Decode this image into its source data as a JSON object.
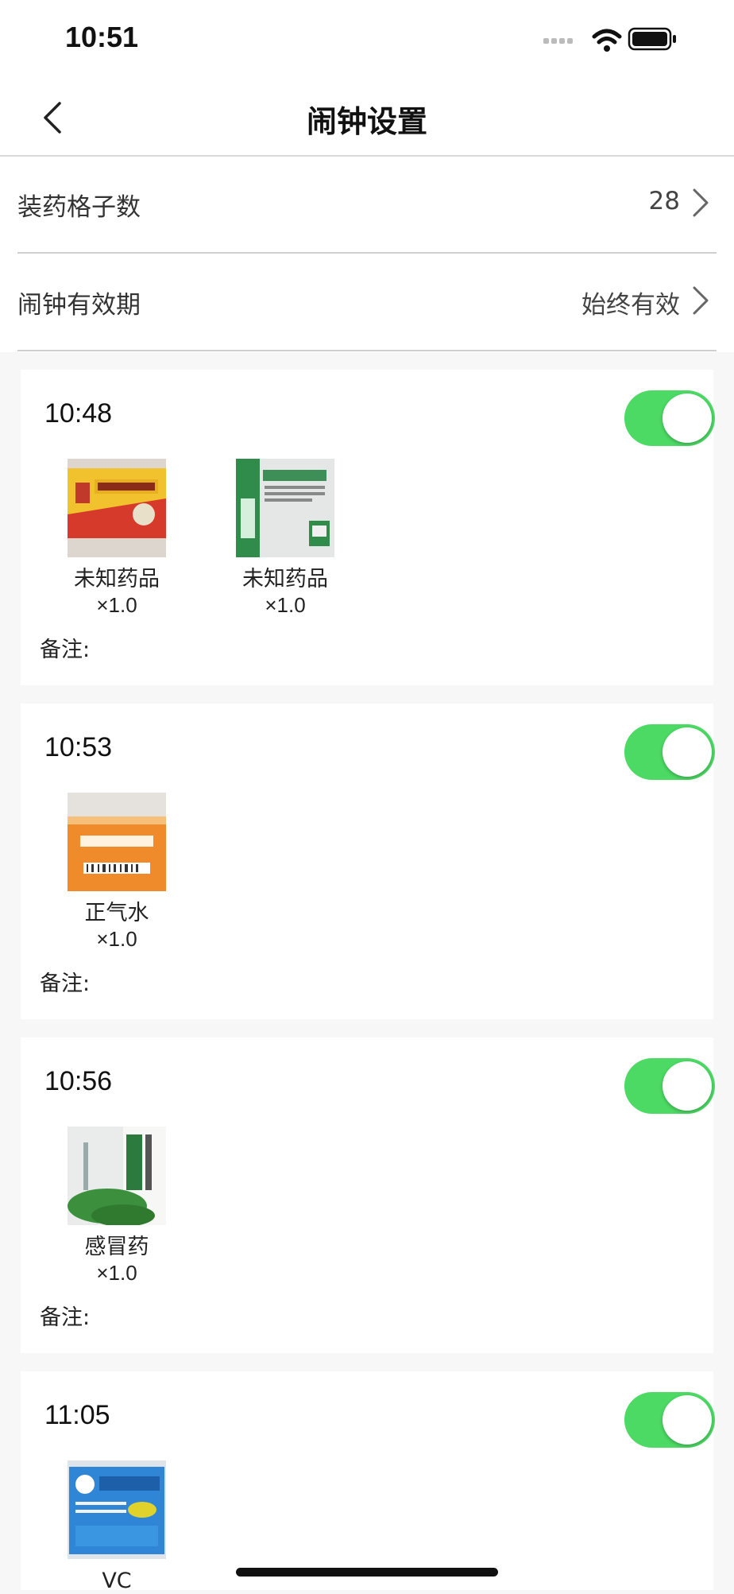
{
  "status": {
    "time": "10:51"
  },
  "nav": {
    "title": "闹钟设置"
  },
  "settings": [
    {
      "label": "装药格子数",
      "value": "28"
    },
    {
      "label": "闹钟有效期",
      "value": "始终有效"
    }
  ],
  "alarms": [
    {
      "time": "10:48",
      "enabled": true,
      "medicines": [
        {
          "name": "未知药品",
          "qty": "×1.0",
          "image": "牛黄上清丸 box"
        },
        {
          "name": "未知药品",
          "qty": "×1.0",
          "image": "胃舒胶片 box"
        }
      ],
      "note_label": "备注:"
    },
    {
      "time": "10:53",
      "enabled": true,
      "medicines": [
        {
          "name": "正气水",
          "qty": "×1.0",
          "image": "藿香正气水 box"
        }
      ],
      "note_label": "备注:"
    },
    {
      "time": "10:56",
      "enabled": true,
      "medicines": [
        {
          "name": "感冒药",
          "qty": "×1.0",
          "image": "风寒感冒颗粒 box"
        }
      ],
      "note_label": "备注:"
    },
    {
      "time": "11:05",
      "enabled": true,
      "medicines": [
        {
          "name": "VC",
          "qty": "",
          "image": "维C银翘片 box"
        }
      ],
      "note_label": ""
    }
  ],
  "colors": {
    "toggle_on": "#4cd964",
    "background": "#f7f7f7"
  }
}
